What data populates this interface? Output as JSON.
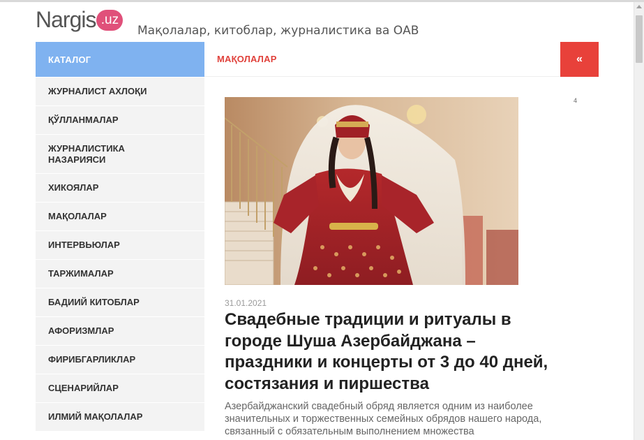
{
  "header": {
    "logo_text": "Nargis",
    "logo_badge": ".uz",
    "tagline": "Мақолалар, китоблар, журналистика ва ОАВ"
  },
  "sidebar": {
    "title": "КАТАЛОГ",
    "items": [
      {
        "label": "ЖУРНАЛИСТ АХЛОҚИ"
      },
      {
        "label": "ҚЎЛЛАНМАЛАР"
      },
      {
        "label": "ЖУРНАЛИСТИКА НАЗАРИЯСИ"
      },
      {
        "label": "ХИКОЯЛАР"
      },
      {
        "label": "МАҚОЛАЛАР"
      },
      {
        "label": "ИНТЕРВЬЮЛАР"
      },
      {
        "label": "ТАРЖИМАЛАР"
      },
      {
        "label": "БАДИИЙ КИТОБЛАР"
      },
      {
        "label": "АФОРИЗМЛАР"
      },
      {
        "label": "ФИРИБГАРЛИКЛАР"
      },
      {
        "label": "СЦЕНАРИЙЛАР"
      },
      {
        "label": "ИЛМИЙ МАҚОЛАЛАР"
      }
    ]
  },
  "main": {
    "section_title": "МАҚОЛАЛАР",
    "collapse_label": "«",
    "counter": "4",
    "article": {
      "date": "31.01.2021",
      "title": "Свадебные традиции и ритуалы в городе Шуша Азербайджана – праздники и концерты от 3 до 40 дней, состязания и пиршества",
      "excerpt": "Азербайджанский свадебный обряд является одним из наиболее значительных и торжественных семейных обрядов нашего народа, связанный с обязательным выполнением множества"
    }
  },
  "colors": {
    "catalog_bg": "#7fb2f0",
    "accent_red": "#e8413a",
    "logo_pink": "#e0507a"
  }
}
